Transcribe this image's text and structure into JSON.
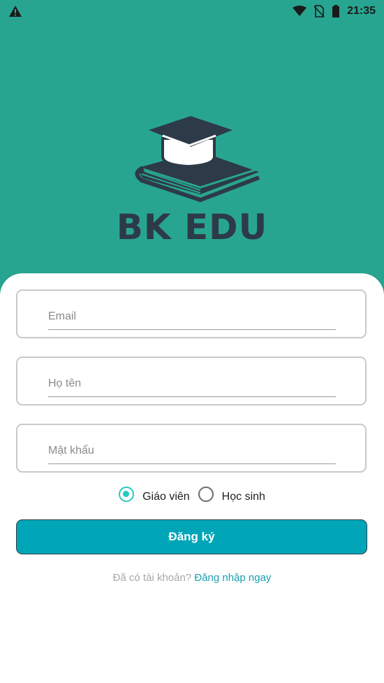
{
  "status_bar": {
    "time": "21:35",
    "alert_icon": "warning-icon",
    "wifi_icon": "wifi-icon",
    "no_sim_icon": "no-sim-icon",
    "battery_icon": "battery-icon"
  },
  "brand": {
    "name": "BK EDU",
    "logo_icon": "graduation-book-icon"
  },
  "form": {
    "email_placeholder": "Email",
    "fullname_placeholder": "Họ tên",
    "password_placeholder": "Mật khẩu",
    "roles": [
      {
        "label": "Giáo viên",
        "selected": true
      },
      {
        "label": "Học sinh",
        "selected": false
      }
    ],
    "submit_label": "Đăng ký",
    "have_account_text": "Đã có tài khoản?",
    "login_link": "Đăng nhập ngay"
  },
  "colors": {
    "background": "#28a590",
    "brand_text": "#2d3a47",
    "button": "#00a6b8",
    "radio_accent": "#25c8c0",
    "link": "#1d9fb0"
  }
}
